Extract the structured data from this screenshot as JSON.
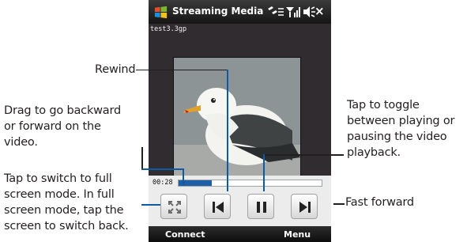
{
  "app": {
    "title": "Streaming Media",
    "status_icons": "connectivity-icon, signal-icon, volume-icon",
    "close_label": "×"
  },
  "player": {
    "file_name": "test3.3gp",
    "elapsed_time": "00:28",
    "progress_fraction": 0.23
  },
  "softkeys": {
    "left": "Connect",
    "right": "Menu"
  },
  "callouts": {
    "rewind": "Rewind",
    "drag_lines": [
      "Drag to go backward",
      "or forward on the",
      "video."
    ],
    "fullscreen_lines": [
      "Tap to switch to full",
      "screen mode. In full",
      "screen mode, tap the",
      "screen to switch back."
    ],
    "toggle_lines": [
      "Tap to toggle",
      "between playing or",
      "pausing the video",
      "playback."
    ],
    "fast_forward": "Fast forward"
  },
  "colors": {
    "accent": "#1f5fa6",
    "titlebar": "#1a1a1a",
    "content_bg": "#312c30",
    "controls_bg": "#ececec"
  }
}
